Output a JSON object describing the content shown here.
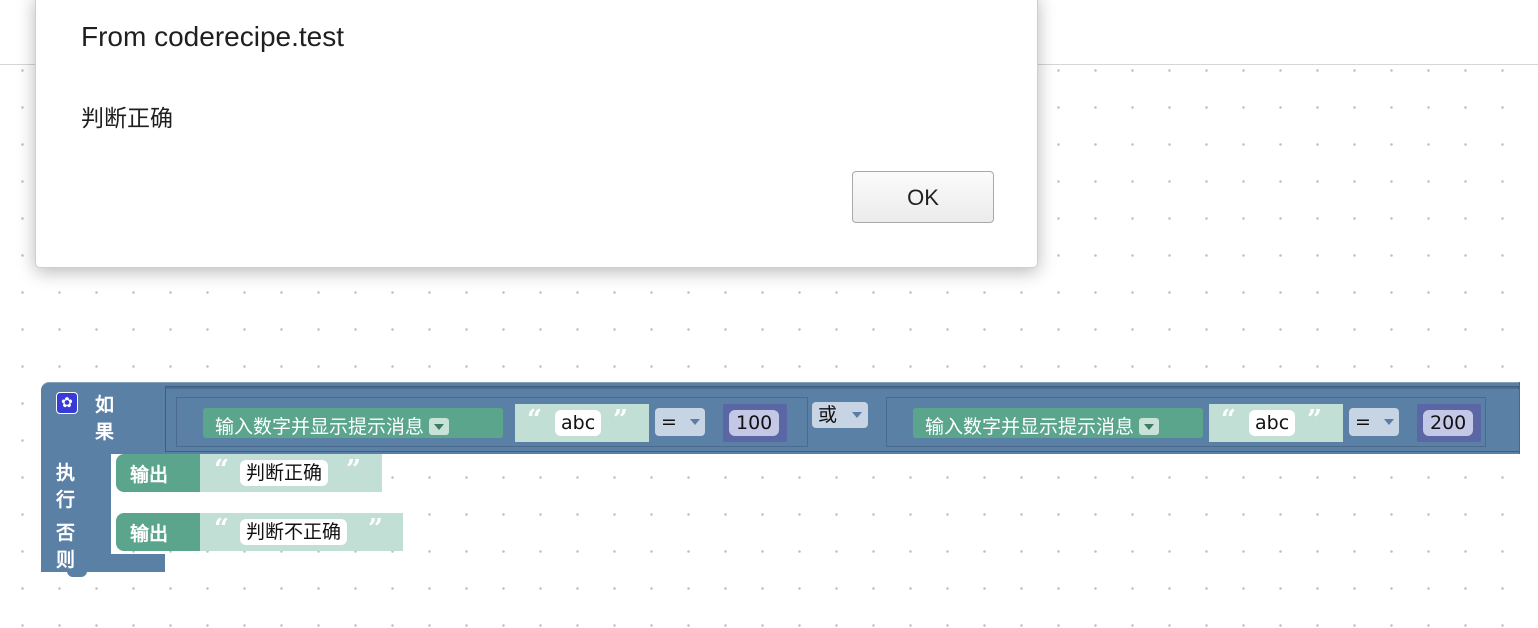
{
  "dialog": {
    "title": "From coderecipe.test",
    "message": "判断正确",
    "ok_label": "OK"
  },
  "if_block": {
    "if_label": "如果",
    "do_label": "执行",
    "else_label": "否则",
    "settings_icon": "gear-icon",
    "logic_operator": "或",
    "conditions": [
      {
        "prompt_label": "输入数字并显示提示消息",
        "prompt_text": "abc",
        "operator": "=",
        "value": "100"
      },
      {
        "prompt_label": "输入数字并显示提示消息",
        "prompt_text": "abc",
        "operator": "=",
        "value": "200"
      }
    ],
    "do_print": {
      "label": "输出",
      "text": "判断正确"
    },
    "else_print": {
      "label": "输出",
      "text": "判断不正确"
    }
  },
  "colors": {
    "logic_block": "#5b80a5",
    "text_block": "#5ba58c",
    "math_block": "#5b67a5",
    "dialog_bg": "#ffffff"
  }
}
